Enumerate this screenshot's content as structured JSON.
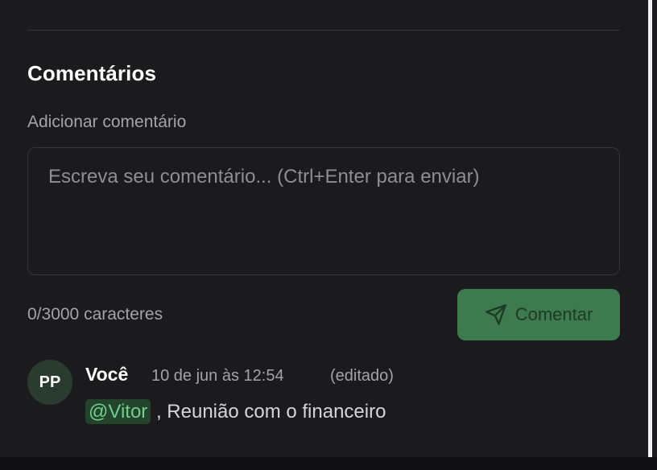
{
  "section": {
    "title": "Comentários"
  },
  "form": {
    "label": "Adicionar comentário",
    "placeholder": "Escreva seu comentário... (Ctrl+Enter para enviar)",
    "value": "",
    "char_count": "0/3000 caracteres",
    "submit_label": "Comentar",
    "submit_icon": "send-icon"
  },
  "comments": [
    {
      "avatar_initials": "PP",
      "author": "Você",
      "timestamp": "10 de jun às 12:54",
      "edited": "(editado)",
      "mention": "@Vitor",
      "text": " , Reunião com o financeiro"
    }
  ],
  "colors": {
    "background": "#1b1b1d",
    "accent_button": "#3d7a4d",
    "mention_bg": "#24432c",
    "mention_text": "#6fd08a"
  }
}
